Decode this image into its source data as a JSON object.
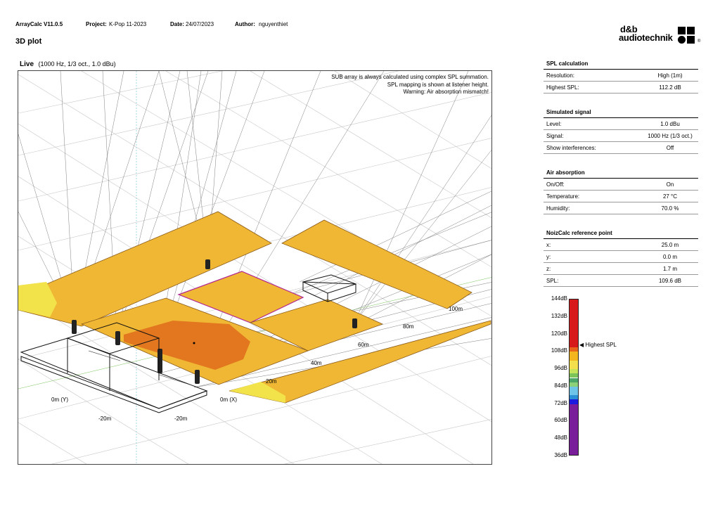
{
  "header": {
    "app": "ArrayCalc V11.0.5",
    "project_label": "Project:",
    "project": "K-Pop 11-2023",
    "date_label": "Date:",
    "date": "24/07/2023",
    "author_label": "Author:",
    "author": "nguyenthiet"
  },
  "page_title": "3D plot",
  "logo": {
    "line1": "d&b",
    "line2": "audiotechnik",
    "mark": "®"
  },
  "plot": {
    "mode": "Live",
    "params": "(1000 Hz, 1/3 oct., 1.0 dBu)",
    "notes": [
      "SUB array is always calculated using complex SPL summation.",
      "SPL mapping is shown at listener height.",
      "Warning: Air absorption mismatch!"
    ],
    "distance_labels": [
      "100m",
      "80m",
      "60m",
      "40m",
      "20m",
      "0m (X)",
      "0m (Y)",
      "-20m",
      "-20m"
    ]
  },
  "spl_calculation": {
    "title": "SPL calculation",
    "rows": [
      {
        "label": "Resolution:",
        "value": "High (1m)"
      },
      {
        "label": "Highest SPL:",
        "value": "112.2 dB"
      }
    ]
  },
  "simulated_signal": {
    "title": "Simulated signal",
    "rows": [
      {
        "label": "Level:",
        "value": "1.0 dBu"
      },
      {
        "label": "Signal:",
        "value": "1000 Hz (1/3 oct.)"
      },
      {
        "label": "Show interferences:",
        "value": "Off"
      }
    ]
  },
  "air_absorption": {
    "title": "Air absorption",
    "rows": [
      {
        "label": "On/Off:",
        "value": "On"
      },
      {
        "label": "Temperature:",
        "value": "27 °C"
      },
      {
        "label": "Humidity:",
        "value": "70.0 %"
      }
    ]
  },
  "noizcalc": {
    "title": "NoizCalc reference point",
    "rows": [
      {
        "label": "x:",
        "value": "25.0 m"
      },
      {
        "label": "y:",
        "value": "0.0 m"
      },
      {
        "label": "z:",
        "value": "1.7 m"
      },
      {
        "label": "SPL:",
        "value": "109.6 dB"
      }
    ]
  },
  "legend": {
    "ticks": [
      "144dB",
      "132dB",
      "120dB",
      "108dB",
      "96dB",
      "84dB",
      "72dB",
      "60dB",
      "48dB",
      "36dB"
    ],
    "marker_label": "Highest SPL",
    "highest_spl_db": 112.2,
    "range_db": [
      36,
      144
    ],
    "bands": [
      {
        "from": 144,
        "to": 111,
        "color": "#d7191c"
      },
      {
        "from": 111,
        "to": 108,
        "color": "#e8641b"
      },
      {
        "from": 108,
        "to": 102,
        "color": "#f3b61f"
      },
      {
        "from": 102,
        "to": 96,
        "color": "#f4e04d"
      },
      {
        "from": 96,
        "to": 93,
        "color": "#c6e35a"
      },
      {
        "from": 93,
        "to": 90,
        "color": "#7cc45a"
      },
      {
        "from": 90,
        "to": 87,
        "color": "#4ca66a"
      },
      {
        "from": 87,
        "to": 84,
        "color": "#8cd07a"
      },
      {
        "from": 84,
        "to": 78,
        "color": "#6ec3e8"
      },
      {
        "from": 78,
        "to": 75,
        "color": "#2b8fd6"
      },
      {
        "from": 75,
        "to": 72,
        "color": "#1d1ae0"
      },
      {
        "from": 72,
        "to": 36,
        "color": "#7a1d9a"
      }
    ]
  },
  "colors": {
    "map_yellow": "#efb733",
    "map_orange": "#e2771f",
    "map_light": "#f2e34a",
    "map_edge": "#8a5a1a",
    "stage_highlight": "#b1248f"
  }
}
